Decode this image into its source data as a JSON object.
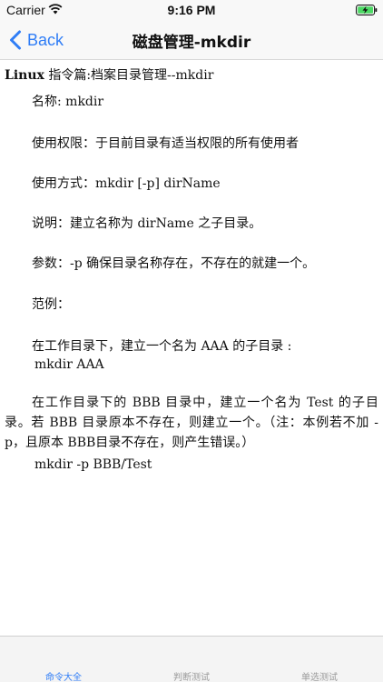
{
  "status_bar": {
    "carrier": "Carrier",
    "time": "9:16 PM",
    "wifi_icon": "wifi-icon",
    "battery_icon": "battery-charging-icon",
    "battery_color": "#4cd964"
  },
  "nav": {
    "back_label": "Back",
    "title": "磁盘管理-mkdir",
    "accent_color": "#2f7df6"
  },
  "doc": {
    "heading_latin": "Linux",
    "heading_rest": " 指令篇:档案目录管理--mkdir",
    "name_line": "名称:  mkdir",
    "permission_line": "使用权限：于目前目录有适当权限的所有使用者",
    "usage_line": "使用方式：mkdir [-p] dirName",
    "desc_line": "说明：建立名称为 dirName 之子目录。",
    "params_line": "参数：-p 确保目录名称存在，不存在的就建一个。",
    "example_label": "范例：",
    "example1_text": "在工作目录下，建立一个名为 AAA 的子目录 :",
    "example1_cmd": "mkdir AAA",
    "example2_text": "在工作目录下的 BBB 目录中，建立一个名为 Test 的子目录。若 BBB 目录原本不存在，则建立一个。（注：本例若不加 -p，且原本 BBB目录不存在，则产生错误。）",
    "example2_cmd": "mkdir -p BBB/Test"
  },
  "tabs": [
    {
      "label": "命令大全",
      "active": true
    },
    {
      "label": "判断测试",
      "active": false
    },
    {
      "label": "单选测试",
      "active": false
    }
  ]
}
